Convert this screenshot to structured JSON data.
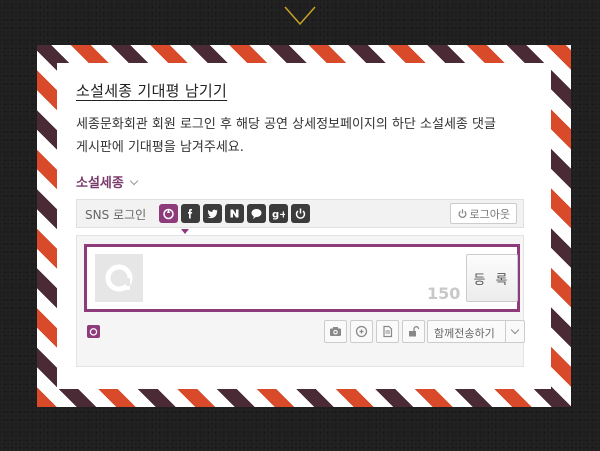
{
  "header": {
    "chevron_icon": "chevron-down-icon"
  },
  "title": "소설세종 기대평 남기기",
  "description_line1": "세종문화회관 회원 로그인 후 해당 공연 상세정보페이지의 하단 소설세종 댓글",
  "description_line2": "게시판에 기대평을 남겨주세요.",
  "venue": {
    "label": "소설세종"
  },
  "sns": {
    "label": "SNS 로그인",
    "icons": [
      "sejong-icon",
      "facebook-icon",
      "twitter-icon",
      "naver-icon",
      "talk-icon",
      "googleplus-icon",
      "power-icon"
    ],
    "logout_label": "로그아웃"
  },
  "comment": {
    "value": "",
    "counter": "150",
    "submit_label": "등 록"
  },
  "tools": [
    "camera-icon",
    "link-icon",
    "document-icon",
    "lock-icon"
  ],
  "share": {
    "label": "함께전송하기"
  },
  "colors": {
    "accent": "#8e3b7c",
    "stripe_red": "#d94a2b",
    "stripe_dark": "#4a2a35",
    "chevron": "#c9a227"
  }
}
